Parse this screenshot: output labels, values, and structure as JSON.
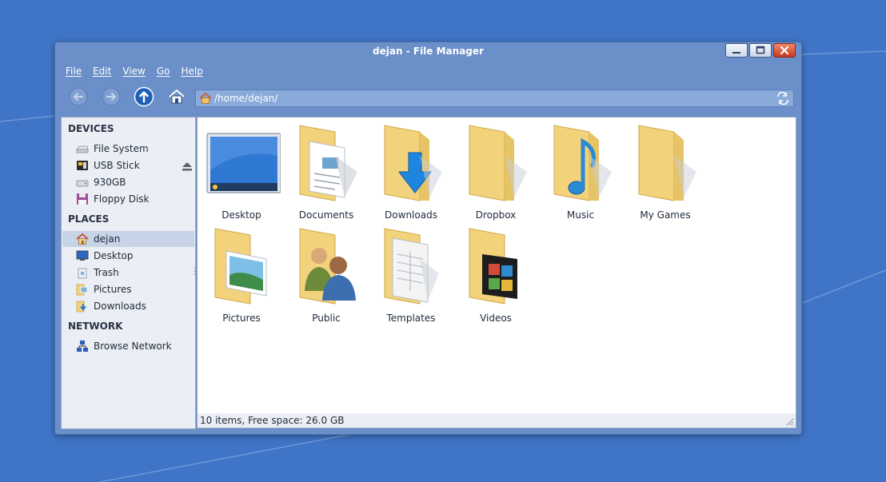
{
  "window": {
    "title": "dejan - File Manager"
  },
  "menu": [
    "File",
    "Edit",
    "View",
    "Go",
    "Help"
  ],
  "toolbar": {
    "back_icon": "arrow-left-icon",
    "forward_icon": "arrow-right-icon",
    "up_icon": "arrow-up-icon",
    "home_icon": "home-icon"
  },
  "path": {
    "value": "/home/dejan/"
  },
  "sidebar": {
    "devices_header": "DEVICES",
    "devices": [
      {
        "label": "File System",
        "icon": "harddisk-icon"
      },
      {
        "label": "USB Stick",
        "icon": "usb-icon"
      },
      {
        "label": "930GB",
        "icon": "drive-icon"
      },
      {
        "label": "Floppy Disk",
        "icon": "floppy-icon"
      }
    ],
    "places_header": "PLACES",
    "places": [
      {
        "label": "dejan",
        "icon": "home-icon",
        "selected": true
      },
      {
        "label": "Desktop",
        "icon": "desktop-icon"
      },
      {
        "label": "Trash",
        "icon": "trash-icon"
      },
      {
        "label": "Pictures",
        "icon": "pictures-folder-icon"
      },
      {
        "label": "Downloads",
        "icon": "downloads-folder-icon"
      }
    ],
    "network_header": "NETWORK",
    "network": [
      {
        "label": "Browse Network",
        "icon": "network-icon"
      }
    ]
  },
  "files": [
    {
      "name": "Desktop",
      "icon": "desktop-icon"
    },
    {
      "name": "Documents",
      "icon": "documents-folder-icon"
    },
    {
      "name": "Downloads",
      "icon": "downloads-folder-icon"
    },
    {
      "name": "Dropbox",
      "icon": "folder-icon"
    },
    {
      "name": "Music",
      "icon": "music-folder-icon"
    },
    {
      "name": "My Games",
      "icon": "folder-icon"
    },
    {
      "name": "Pictures",
      "icon": "pictures-folder-icon"
    },
    {
      "name": "Public",
      "icon": "public-folder-icon"
    },
    {
      "name": "Templates",
      "icon": "templates-folder-icon"
    },
    {
      "name": "Videos",
      "icon": "videos-folder-icon"
    }
  ],
  "status": {
    "text": "10 items, Free space: 26.0 GB"
  },
  "colors": {
    "desktop_bg": "#3f74c6",
    "window_frame": "#6a8fc9",
    "selection": "#c7d3e6",
    "folder": "#f2d27a"
  }
}
